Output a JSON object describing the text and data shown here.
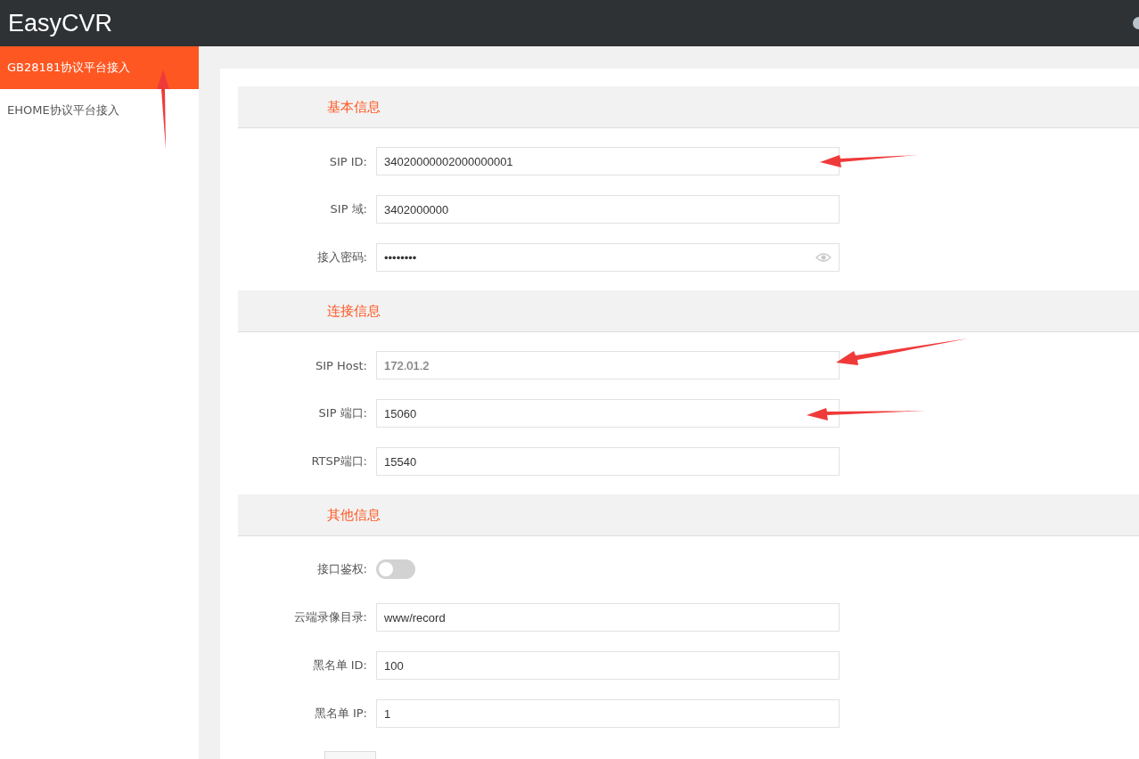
{
  "header": {
    "title": "EasyCVR"
  },
  "sidebar": {
    "items": [
      {
        "label": "GB28181协议平台接入",
        "selected": true
      },
      {
        "label": "EHOME协议平台接入",
        "selected": false
      }
    ]
  },
  "sections": [
    {
      "title": "基本信息",
      "fields": [
        {
          "kind": "text",
          "label": "SIP ID:",
          "value": "34020000002000000001"
        },
        {
          "kind": "text",
          "label": "SIP 域:",
          "value": "3402000000"
        },
        {
          "kind": "password",
          "label": "接入密码:",
          "value": "••••••••"
        }
      ]
    },
    {
      "title": "连接信息",
      "fields": [
        {
          "kind": "text",
          "label": "SIP Host:",
          "value": "172.01.2",
          "blurred": true
        },
        {
          "kind": "text",
          "label": "SIP 端口:",
          "value": "15060"
        },
        {
          "kind": "text",
          "label": "RTSP端口:",
          "value": "15540"
        }
      ]
    },
    {
      "title": "其他信息",
      "fields": [
        {
          "kind": "toggle",
          "label": "接口鉴权:",
          "on": false
        },
        {
          "kind": "text",
          "label": "云端录像目录:",
          "value": "www/record"
        },
        {
          "kind": "text",
          "label": "黑名单 ID:",
          "value": "100"
        },
        {
          "kind": "text",
          "label": "黑名单 IP:",
          "value": "1"
        }
      ]
    }
  ]
}
